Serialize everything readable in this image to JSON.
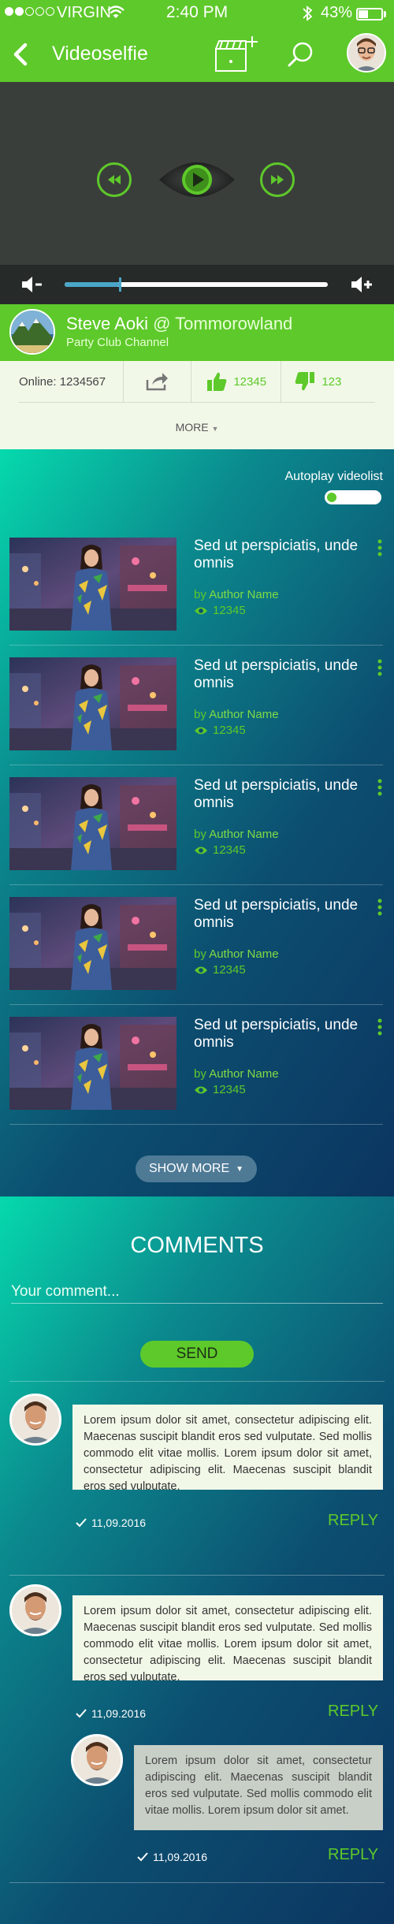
{
  "status_bar": {
    "carrier": "VIRGIN",
    "time": "2:40 PM",
    "battery": "43%",
    "battery_level": 0.43,
    "signal_bars": 2
  },
  "nav": {
    "title": "Videoselfie",
    "icons": [
      "back-icon",
      "clapperboard-add-icon",
      "search-icon",
      "avatar"
    ]
  },
  "player": {
    "progress": 0.21
  },
  "channel": {
    "name": "Steve Aoki",
    "at": "@ Tommorowland",
    "subtitle": "Party Club Channel"
  },
  "stats": {
    "online_label": "Online:",
    "online_count": "1234567",
    "likes": "12345",
    "dislikes": "123",
    "more": "MORE"
  },
  "autoplay": {
    "label": "Autoplay videolist",
    "enabled": true
  },
  "videos": [
    {
      "title": "Sed ut perspiciatis, unde omnis",
      "by": "by",
      "author": "Author Name",
      "views": "12345"
    },
    {
      "title": "Sed ut perspiciatis, unde omnis",
      "by": "by",
      "author": "Author Name",
      "views": "12345"
    },
    {
      "title": "Sed ut perspiciatis, unde omnis",
      "by": "by",
      "author": "Author Name",
      "views": "12345"
    },
    {
      "title": "Sed ut perspiciatis, unde omnis",
      "by": "by",
      "author": "Author Name",
      "views": "12345"
    },
    {
      "title": "Sed ut perspiciatis, unde omnis",
      "by": "by",
      "author": "Author Name",
      "views": "12345"
    }
  ],
  "show_more": "SHOW MORE",
  "comments_section": {
    "title": "COMMENTS",
    "placeholder": "Your comment...",
    "send": "SEND"
  },
  "comments": [
    {
      "text": "Lorem ipsum dolor sit amet, consectetur adipiscing elit. Maecenas suscipit blandit eros sed vulputate. Sed mollis commodo elit vitae mollis. Lorem ipsum dolor sit amet, consectetur adipiscing elit. Maecenas suscipit blandit eros sed vulputate.",
      "date": "11,09.2016",
      "reply": "REPLY"
    },
    {
      "text": "Lorem ipsum dolor sit amet, consectetur adipiscing elit. Maecenas suscipit blandit eros sed vulputate. Sed mollis commodo elit vitae mollis. Lorem ipsum dolor sit amet, consectetur adipiscing elit. Maecenas suscipit blandit eros sed vulputate.",
      "date": "11,09.2016",
      "reply": "REPLY"
    },
    {
      "text": "Lorem ipsum dolor sit amet, consectetur adipiscing elit. Maecenas suscipit blandit eros sed vulputate. Sed mollis commodo elit vitae mollis. Lorem ipsum dolor sit amet.",
      "date": "11,09.2016",
      "reply": "REPLY"
    }
  ],
  "colors": {
    "accent": "#5ec92a",
    "player_bg": "#3a3e3b",
    "panel_bg": "#f1f8e8",
    "gradient_start": "#06d9ad",
    "gradient_end": "#0b3560"
  }
}
